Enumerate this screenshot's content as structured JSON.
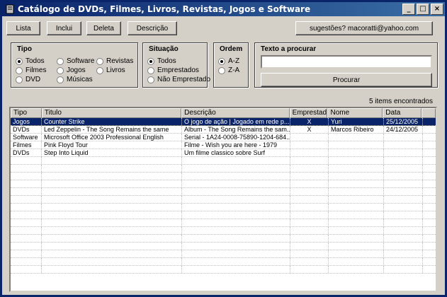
{
  "window": {
    "title": "Catálogo de DVDs, Filmes, Livros, Revistas, Jogos e Software",
    "controls": [
      "_",
      "□",
      "×"
    ]
  },
  "toolbar": {
    "lista": "Lista",
    "inclui": "Inclui",
    "deleta": "Deleta",
    "descricao": "Descrição",
    "sugestoes": "sugestões? macoratti@yahoo.com"
  },
  "tipo": {
    "title": "Tipo",
    "options": [
      "Todos",
      "Filmes",
      "DVD",
      "Software",
      "Jogos",
      "Músicas",
      "Revistas",
      "Livros"
    ],
    "selected": "Todos"
  },
  "situacao": {
    "title": "Situação",
    "options": [
      "Todos",
      "Emprestados",
      "Não Emprestado"
    ],
    "selected": "Todos"
  },
  "ordem": {
    "title": "Ordem",
    "options": [
      "A-Z",
      "Z-A"
    ],
    "selected": "A-Z"
  },
  "search": {
    "title": "Texto a procurar",
    "value": "",
    "button": "Procurar"
  },
  "status": {
    "count": "5 items encontrados"
  },
  "grid": {
    "columns": [
      "Tipo",
      "Titulo",
      "Descrição",
      "Emprestado",
      "Nome",
      "Data"
    ],
    "rows": [
      [
        "Jogos",
        "Counter Strike",
        "O jogo de ação | Jogado em rede p...",
        "X",
        "Yuri",
        "25/12/2005"
      ],
      [
        "DVDs",
        "Led Zeppelin - The Song Remains the same",
        "Album - The Song Remains the sam...",
        "X",
        "Marcos Ribeiro",
        "24/12/2005"
      ],
      [
        "Software",
        "Microsoft Office 2003 Professional English",
        "Serial - 1A24-0008-75890-1204-684...",
        "",
        "",
        ""
      ],
      [
        "Filmes",
        "Pink Floyd Tour",
        "Filme  - Wish you are here - 1979",
        "",
        "",
        ""
      ],
      [
        "DVDs",
        "Step Into Liquid",
        "Um filme classico sobre Surf",
        "",
        "",
        ""
      ]
    ],
    "selected_row": 0
  },
  "colors": {
    "title_start": "#0a246a",
    "title_end": "#3a6ea5",
    "face": "#d4d0c8",
    "selection": "#0a246a"
  },
  "icons": {
    "app": "book-icon"
  }
}
